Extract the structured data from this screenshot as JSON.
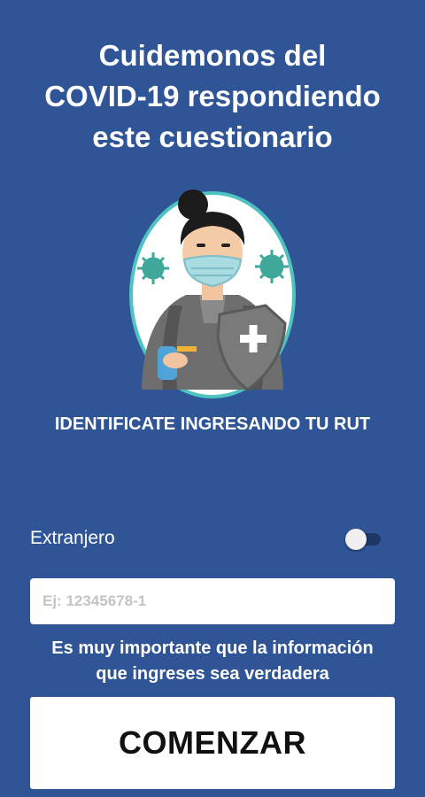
{
  "header": {
    "title_lines": [
      "Cuidemonos del",
      "COVID-19 respondiendo",
      "este cuestionario"
    ]
  },
  "illustration": {
    "icon": "health-worker-shield-illustration"
  },
  "identify_label": "IDENTIFICATE INGRESANDO TU RUT",
  "foreigner": {
    "label": "Extranjero",
    "toggle_on": false
  },
  "rut_input": {
    "value": "",
    "placeholder": "Ej: 12345678-1"
  },
  "note_lines": [
    "Es muy importante que la información",
    "que ingreses sea verdadera"
  ],
  "start_button": {
    "label": "COMENZAR"
  },
  "colors": {
    "background": "#2f5597",
    "accent": "#4fc3c0",
    "button_bg": "#ffffff"
  }
}
